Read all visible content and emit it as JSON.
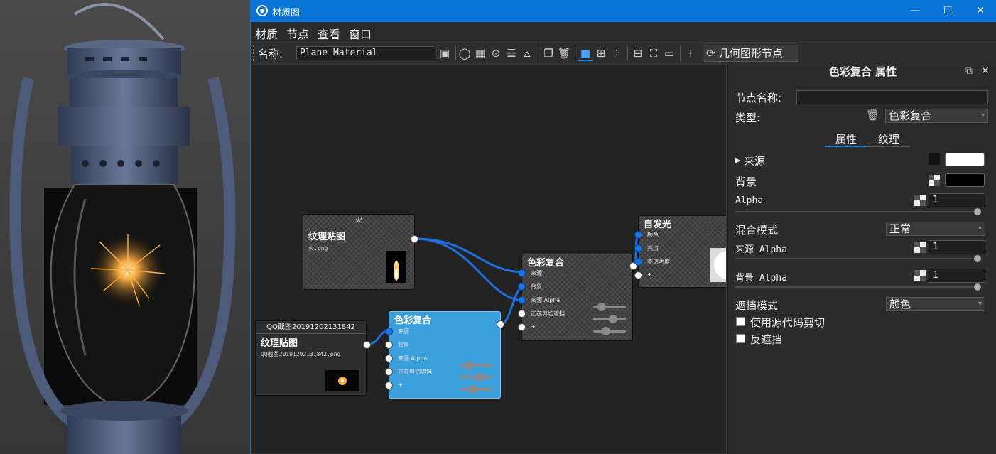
{
  "window": {
    "title": "材质图",
    "minimize": "—",
    "maximize": "☐",
    "close": "✕"
  },
  "menu": [
    "材质",
    "节点",
    "查看",
    "窗口"
  ],
  "toolbar": {
    "name_label": "名称:",
    "name_value": "Plane Material",
    "geometry_button": "几何图形节点"
  },
  "nodes": {
    "texture_top": {
      "header": "火",
      "title": "纹理贴图",
      "subtitle": "火.png"
    },
    "texture_bottom": {
      "header": "QQ截图20191202131842",
      "title": "纹理贴图",
      "subtitle": "QQ截图20191202131842.png"
    },
    "blend_selected": {
      "title": "色彩复合",
      "ports": [
        "来源",
        "背景",
        "来源 Alpha",
        "正在剪切遮挡",
        "+"
      ]
    },
    "blend_main": {
      "title": "色彩复合",
      "ports": [
        "来源",
        "背景",
        "来源 Alpha",
        "正在剪切遮挡",
        "+"
      ]
    },
    "emission": {
      "title": "自发光",
      "ports": [
        "颜色",
        "亮点",
        "不透明度",
        "+"
      ]
    }
  },
  "panel": {
    "title": "色彩复合  属性",
    "node_name_label": "节点名称:",
    "node_name_value": "",
    "type_label": "类型:",
    "type_value": "色彩复合",
    "tabs": [
      "属性",
      "纹理"
    ],
    "source_label": "来源",
    "background_label": "背景",
    "alpha_label": "Alpha",
    "alpha_value": "1",
    "blend_mode_label": "混合模式",
    "blend_mode_value": "正常",
    "source_alpha_label": "来源 Alpha",
    "source_alpha_value": "1",
    "background_alpha_label": "背景 Alpha",
    "background_alpha_value": "1",
    "mask_mode_label": "遮挡模式",
    "mask_mode_value": "颜色",
    "use_source_clip_label": "使用源代码剪切",
    "invert_mask_label": "反遮挡",
    "colors": {
      "source_swatch": "#ffffff",
      "background_swatch": "#000000"
    }
  },
  "colors": {
    "titlebar": "#0a74d9",
    "accent": "#1e88e5",
    "selected_node": "#3aa0dc",
    "wire": "#1f6fe0"
  }
}
